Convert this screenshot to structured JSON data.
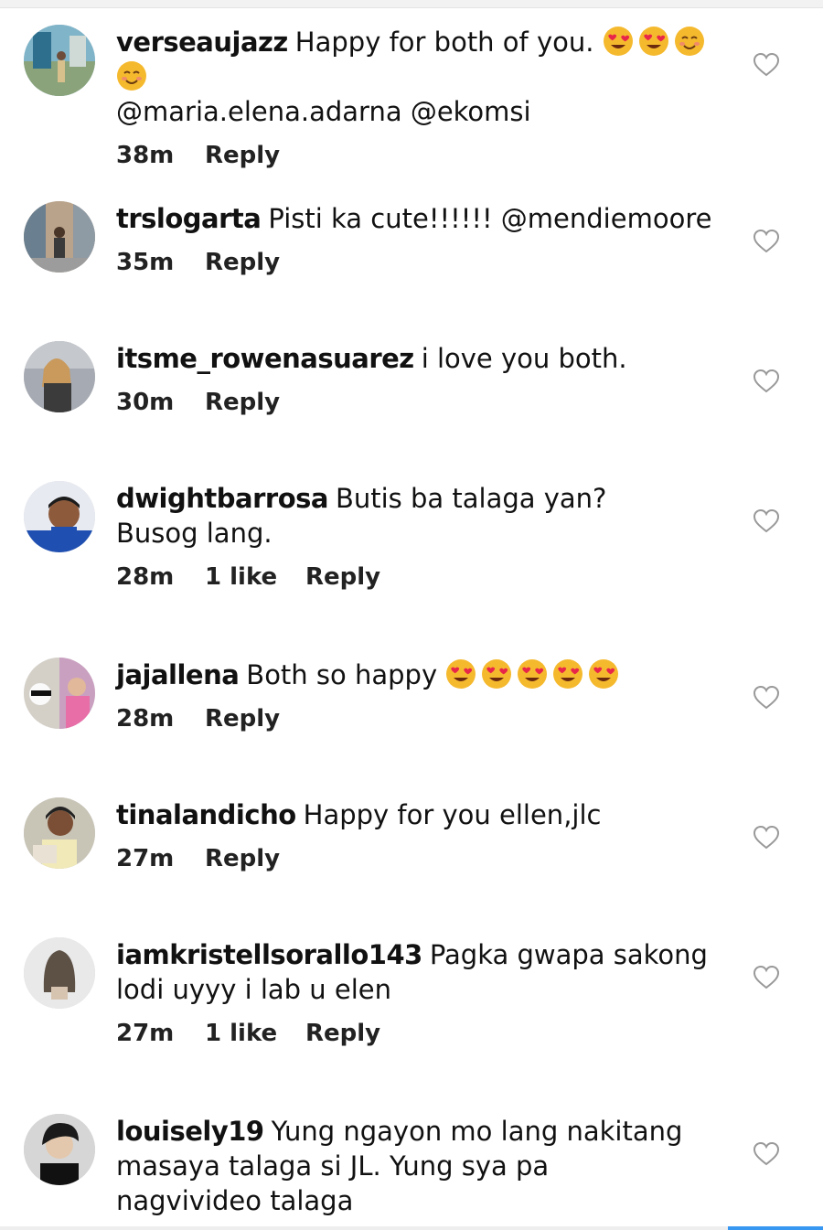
{
  "comments": [
    {
      "username": "verseaujazz",
      "text": "Happy for both of you.",
      "emojis": [
        "heart-eyes",
        "heart-eyes",
        "smiling-blush",
        "smiling-blush"
      ],
      "text_after": "@maria.elena.adarna @ekomsi",
      "time": "38m",
      "likes": "",
      "reply_label": "Reply"
    },
    {
      "username": "trslogarta",
      "text": "Pisti ka cute!!!!!! @mendiemoore",
      "emojis": [],
      "text_after": "",
      "time": "35m",
      "likes": "",
      "reply_label": "Reply"
    },
    {
      "username": "itsme_rowenasuarez",
      "text": "i love you both.",
      "emojis": [],
      "text_after": "",
      "time": "30m",
      "likes": "",
      "reply_label": "Reply"
    },
    {
      "username": "dwightbarrosa",
      "text": "Butis ba talaga yan? Busog lang.",
      "emojis": [],
      "text_after": "",
      "time": "28m",
      "likes": "1 like",
      "reply_label": "Reply"
    },
    {
      "username": "jajallena",
      "text": "Both so happy",
      "emojis": [
        "heart-eyes",
        "heart-eyes",
        "heart-eyes",
        "heart-eyes",
        "heart-eyes"
      ],
      "text_after": "",
      "time": "28m",
      "likes": "",
      "reply_label": "Reply"
    },
    {
      "username": "tinalandicho",
      "text": "Happy for you ellen,jlc",
      "emojis": [],
      "text_after": "",
      "time": "27m",
      "likes": "",
      "reply_label": "Reply"
    },
    {
      "username": "iamkristellsorallo143",
      "text": "Pagka gwapa sakong lodi uyyy i lab u elen",
      "emojis": [],
      "text_after": "",
      "time": "27m",
      "likes": "1 like",
      "reply_label": "Reply"
    },
    {
      "username": "louisely19",
      "text": "Yung ngayon mo lang nakitang masaya talaga si JL. Yung sya pa nagvivideo talaga",
      "emojis": [],
      "text_after": "",
      "time": "",
      "likes": "",
      "reply_label": ""
    }
  ],
  "colors": {
    "accent": "#3897f0",
    "heart_outline": "#999999",
    "emoji_face": "#f5b92e",
    "emoji_heart": "#e8264a"
  },
  "icons": {
    "like": "heart-outline-icon"
  }
}
